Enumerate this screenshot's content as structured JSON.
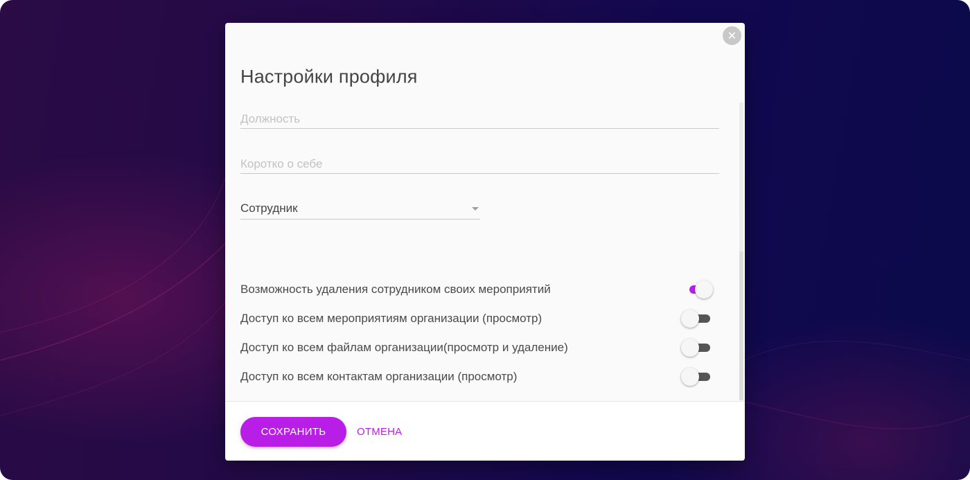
{
  "dialog": {
    "title": "Настройки профиля",
    "close_icon": "close-icon"
  },
  "form": {
    "position": {
      "placeholder": "Должность",
      "value": ""
    },
    "about": {
      "placeholder": "Коротко о себе",
      "value": ""
    },
    "role": {
      "selected": "Сотрудник"
    }
  },
  "permissions": [
    {
      "label": "Возможность удаления сотрудником своих мероприятий",
      "enabled": true
    },
    {
      "label": "Доступ ко всем мероприятиям организации (просмотр)",
      "enabled": false
    },
    {
      "label": "Доступ ко всем файлам организации(просмотр и удаление)",
      "enabled": false
    },
    {
      "label": "Доступ ко всем контактам организации (просмотр)",
      "enabled": false
    }
  ],
  "footer": {
    "save_label": "СОХРАНИТЬ",
    "cancel_label": "ОТМЕНА"
  },
  "colors": {
    "accent": "#b81ee6",
    "background_dark": "#1a0a4a"
  }
}
